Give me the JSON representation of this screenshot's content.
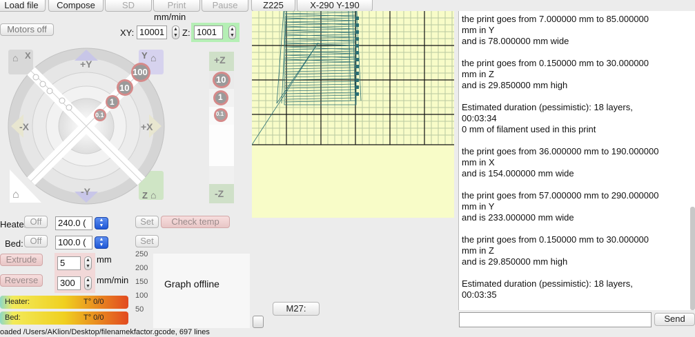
{
  "toolbar": {
    "load_file": "Load file",
    "compose": "Compose",
    "sd": "SD",
    "print": "Print",
    "pause": "Pause",
    "z_pos": "Z225",
    "xy_pos": "X-290 Y-190"
  },
  "motors": {
    "motors_off": "Motors off"
  },
  "feedrate": {
    "title": "mm/min",
    "xy_label": "XY:",
    "xy_value": "10001",
    "z_label": "Z:",
    "z_value": "1001"
  },
  "jog": {
    "home_x": "X",
    "home_y": "Y",
    "home_z": "Z",
    "plus_y": "+Y",
    "minus_y": "-Y",
    "plus_x": "+X",
    "minus_x": "-X",
    "step_100": "100",
    "step_10": "10",
    "step_1": "1",
    "step_01": "0.1",
    "z_plus": "+Z",
    "z_minus": "-Z",
    "z_step_10": "10",
    "z_step_1": "1",
    "z_step_01": "0.1"
  },
  "temps": {
    "heater_label": "Heater:",
    "heater_off": "Off",
    "heater_value": "240.0 (",
    "bed_label": "Bed:",
    "bed_off": "Off",
    "bed_value": "100.0 (",
    "set1": "Set",
    "check_temp": "Check temp",
    "set2": "Set"
  },
  "extrude": {
    "extrude": "Extrude",
    "reverse": "Reverse",
    "length": "5",
    "speed": "300",
    "mm": "mm",
    "mm_min": "mm/min"
  },
  "graph": {
    "offline": "Graph offline",
    "ticks": [
      "250",
      "200",
      "150",
      "100",
      "50"
    ]
  },
  "temp_bars": {
    "heater": "Heater:",
    "heater_t": "T° 0/0",
    "bed": "Bed:",
    "bed_t": "T° 0/0"
  },
  "m27": "M27:",
  "log": [
    [
      "the print goes from 7.000000 mm to 85.000000",
      "mm in Y",
      "and is 78.000000 mm wide"
    ],
    [
      "the print goes from 0.150000 mm to 30.000000",
      "mm in Z",
      "and is 29.850000 mm high"
    ],
    [
      "Estimated duration (pessimistic):  18 layers,",
      "00:03:34",
      "0 mm of filament used in this print"
    ],
    [
      "the print goes from 36.000000 mm to 190.000000",
      "mm in X",
      "and is 154.000000 mm wide"
    ],
    [
      "the print goes from 57.000000 mm to 290.000000",
      "mm in Y",
      "and is 233.000000 mm wide"
    ],
    [
      "the print goes from 0.150000 mm to 30.000000",
      "mm in Z",
      "and is 29.850000 mm high"
    ],
    [
      "Estimated duration (pessimistic):  18 layers,",
      "00:03:35"
    ]
  ],
  "send": {
    "button": "Send",
    "value": ""
  },
  "status": "oaded  /Users/AKlion/Desktop/filenamekfactor.gcode, 697 lines",
  "colors": {
    "preview_bg": "#f8fcc8",
    "grid": "#000000",
    "toolpath": "#2a6f74",
    "accent_green": "#b5efb5"
  }
}
